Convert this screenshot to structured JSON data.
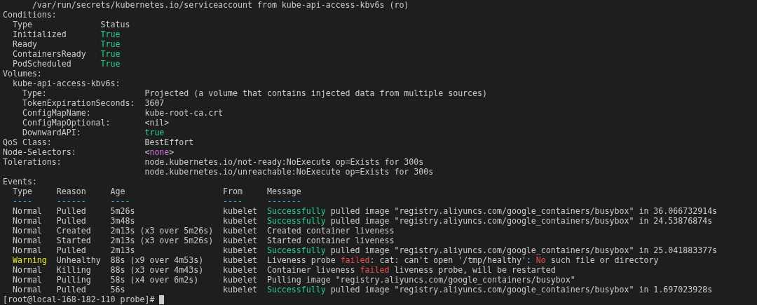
{
  "lines": [
    [
      {
        "text": "      /var/run/secrets/kubernetes.io/serviceaccount from kube-api-access-kbv6s (ro)"
      }
    ],
    [
      {
        "text": "Conditions:"
      }
    ],
    [
      {
        "text": "  Type              Status"
      }
    ],
    [
      {
        "text": "  Initialized       "
      },
      {
        "text": "True",
        "color": "#23d18b"
      }
    ],
    [
      {
        "text": "  Ready             "
      },
      {
        "text": "True",
        "color": "#23d18b"
      }
    ],
    [
      {
        "text": "  ContainersReady   "
      },
      {
        "text": "True",
        "color": "#23d18b"
      }
    ],
    [
      {
        "text": "  PodScheduled      "
      },
      {
        "text": "True",
        "color": "#23d18b"
      }
    ],
    [
      {
        "text": "Volumes:"
      }
    ],
    [
      {
        "text": "  kube-api-access-kbv6s:"
      }
    ],
    [
      {
        "text": "    Type:                    Projected (a volume that contains injected data from multiple sources)"
      }
    ],
    [
      {
        "text": "    TokenExpirationSeconds:  3607"
      }
    ],
    [
      {
        "text": "    ConfigMapName:           kube-root-ca.crt"
      }
    ],
    [
      {
        "text": "    ConfigMapOptional:       <nil>"
      }
    ],
    [
      {
        "text": "    DownwardAPI:             "
      },
      {
        "text": "true",
        "color": "#23d18b"
      }
    ],
    [
      {
        "text": "QoS Class:                   BestEffort"
      }
    ],
    [
      {
        "text": "Node-Selectors:              <"
      },
      {
        "text": "none",
        "color": "#d670d6"
      },
      {
        "text": ">"
      }
    ],
    [
      {
        "text": "Tolerations:                 node.kubernetes.io/not-ready:NoExecute op=Exists for 300s"
      }
    ],
    [
      {
        "text": "                             node.kubernetes.io/unreachable:NoExecute op=Exists for 300s"
      }
    ],
    [
      {
        "text": "Events:"
      }
    ],
    [
      {
        "text": "  Type     Reason     Age                    From     Message"
      }
    ],
    [
      {
        "text": "  ----     ------     ----                   ----     -------",
        "color": "#29b8db"
      }
    ],
    [
      {
        "text": "  Normal   Pulled     5m26s                  kubelet  "
      },
      {
        "text": "Successfully",
        "color": "#23d18b"
      },
      {
        "text": " pulled image \"registry.aliyuncs.com/google_containers/busybox\" in 36.066732914s"
      }
    ],
    [
      {
        "text": "  Normal   Pulled     3m48s                  kubelet  "
      },
      {
        "text": "Successfully",
        "color": "#23d18b"
      },
      {
        "text": " pulled image \"registry.aliyuncs.com/google_containers/busybox\" in 24.53876874s"
      }
    ],
    [
      {
        "text": "  Normal   Created    2m13s (x3 over 5m26s)  kubelet  Created container liveness"
      }
    ],
    [
      {
        "text": "  Normal   Started    2m13s (x3 over 5m26s)  kubelet  Started container liveness"
      }
    ],
    [
      {
        "text": "  Normal   Pulled     2m13s                  kubelet  "
      },
      {
        "text": "Successfully",
        "color": "#23d18b"
      },
      {
        "text": " pulled image \"registry.aliyuncs.com/google_containers/busybox\" in 25.041883377s"
      }
    ],
    [
      {
        "text": "  Warning",
        "color": "#e5e510"
      },
      {
        "text": "  Unhealthy  88s (x9 over 4m53s)    kubelet  Liveness probe "
      },
      {
        "text": "failed",
        "color": "#f14c4c"
      },
      {
        "text": ": cat: can't open '/tmp/healthy': "
      },
      {
        "text": "No",
        "color": "#f14c4c"
      },
      {
        "text": " such file or directory"
      }
    ],
    [
      {
        "text": "  Normal   Killing    88s (x3 over 4m43s)    kubelet  Container liveness "
      },
      {
        "text": "failed",
        "color": "#f14c4c"
      },
      {
        "text": " liveness probe, will be restarted"
      }
    ],
    [
      {
        "text": "  Normal   Pulling    58s (x4 over 6m2s)     kubelet  Pulling image \"registry.aliyuncs.com/google_containers/busybox\""
      }
    ],
    [
      {
        "text": "  Normal   Pulled     56s                    kubelet  "
      },
      {
        "text": "Successfully",
        "color": "#23d18b"
      },
      {
        "text": " pulled image \"registry.aliyuncs.com/google_containers/busybox\" in 1.697023928s"
      }
    ]
  ],
  "prompt": {
    "text": "[root@local-168-182-110 probe]# ",
    "cursor": true
  }
}
